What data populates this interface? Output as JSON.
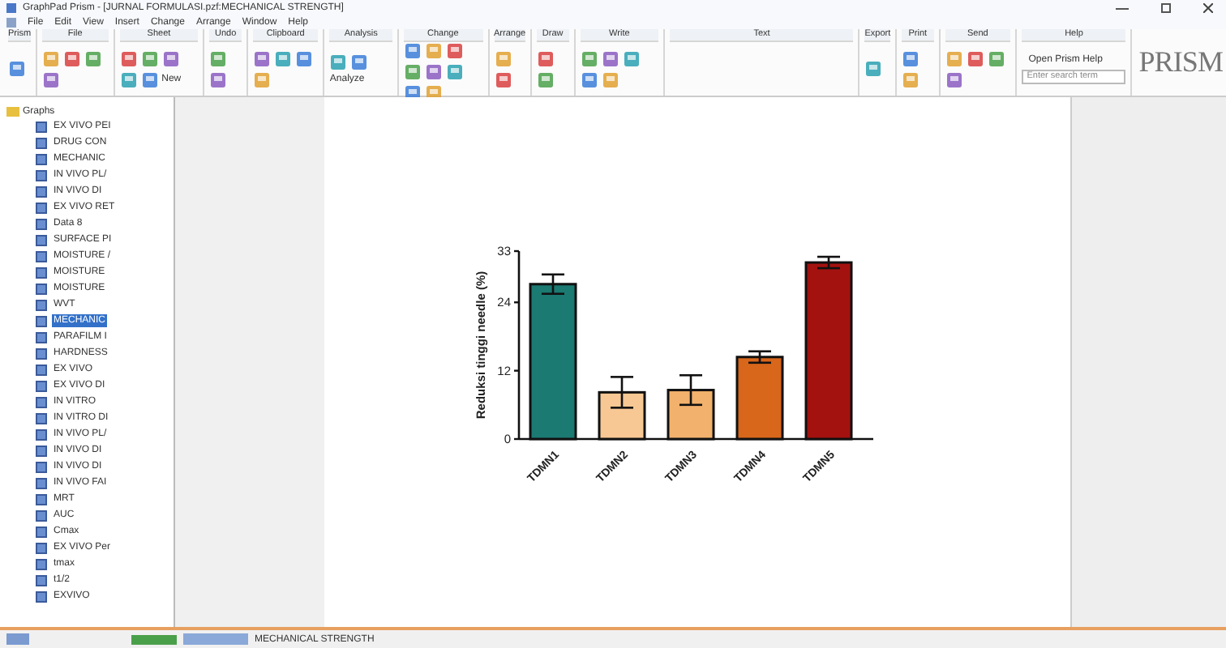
{
  "window": {
    "title": "GraphPad Prism - [JURNAL FORMULASI.pzf:MECHANICAL STRENGTH]"
  },
  "menu": [
    "File",
    "Edit",
    "View",
    "Insert",
    "Change",
    "Arrange",
    "Window",
    "Help"
  ],
  "ribbon": {
    "groups": [
      {
        "label": "Prism"
      },
      {
        "label": "File"
      },
      {
        "label": "Sheet",
        "button": "New"
      },
      {
        "label": "Undo"
      },
      {
        "label": "Clipboard"
      },
      {
        "label": "Analysis",
        "button": "Analyze"
      },
      {
        "label": "Change"
      },
      {
        "label": "Arrange"
      },
      {
        "label": "Draw"
      },
      {
        "label": "Write"
      },
      {
        "label": "Text"
      },
      {
        "label": "Export"
      },
      {
        "label": "Print"
      },
      {
        "label": "Send"
      }
    ],
    "help": {
      "label": "Help",
      "button": "Open Prism Help",
      "search": {
        "placeholder": "Enter search term"
      }
    },
    "logo": "PRISM"
  },
  "tree": {
    "root": "Graphs",
    "children": [
      {
        "label": "EX VIVO PEI",
        "selected": false
      },
      {
        "label": "DRUG CON",
        "selected": false
      },
      {
        "label": "MECHANIC",
        "selected": false
      },
      {
        "label": "IN VIVO PL/",
        "selected": false
      },
      {
        "label": "IN VIVO DI",
        "selected": false
      },
      {
        "label": "EX VIVO RET",
        "selected": false
      },
      {
        "label": "Data 8",
        "selected": false
      },
      {
        "label": "SURFACE PI",
        "selected": false
      },
      {
        "label": "MOISTURE /",
        "selected": false
      },
      {
        "label": "MOISTURE",
        "selected": false
      },
      {
        "label": "MOISTURE",
        "selected": false
      },
      {
        "label": "WVT",
        "selected": false
      },
      {
        "label": "MECHANIC",
        "selected": true
      },
      {
        "label": "PARAFILM I",
        "selected": false
      },
      {
        "label": "HARDNESS",
        "selected": false
      },
      {
        "label": "EX VIVO",
        "selected": false
      },
      {
        "label": "EX VIVO DI",
        "selected": false
      },
      {
        "label": "IN VITRO",
        "selected": false
      },
      {
        "label": "IN VITRO DI",
        "selected": false
      },
      {
        "label": "IN VIVO PL/",
        "selected": false
      },
      {
        "label": "IN VIVO DI",
        "selected": false
      },
      {
        "label": "IN VIVO DI",
        "selected": false
      },
      {
        "label": "IN VIVO FAI",
        "selected": false
      },
      {
        "label": "MRT",
        "selected": false
      },
      {
        "label": "AUC",
        "selected": false
      },
      {
        "label": "Cmax",
        "selected": false
      },
      {
        "label": "EX VIVO Per",
        "selected": false
      },
      {
        "label": "tmax",
        "selected": false
      },
      {
        "label": "t1/2",
        "selected": false
      },
      {
        "label": "EXVIVO",
        "selected": false
      }
    ]
  },
  "graph": {
    "chart_data": {
      "type": "bar",
      "ylabel": "Reduksi tinggi needle (%)",
      "categories": [
        "TDMN1",
        "TDMN2",
        "TDMN3",
        "TDMN4",
        "TDMN5"
      ],
      "ylim": [
        0,
        33
      ],
      "yticks": [
        0,
        12,
        24,
        33
      ],
      "series": [
        {
          "values": [
            27.2,
            8.2,
            8.6,
            14.4,
            31
          ],
          "errors": [
            1.7,
            2.7,
            2.6,
            1,
            1
          ],
          "colors": [
            "#1b7a72",
            "#f7c893",
            "#f2b16c",
            "#d8661b",
            "#a3120f"
          ]
        }
      ]
    }
  },
  "status_bar": {
    "sheet": "MECHANICAL STRENGTH"
  }
}
